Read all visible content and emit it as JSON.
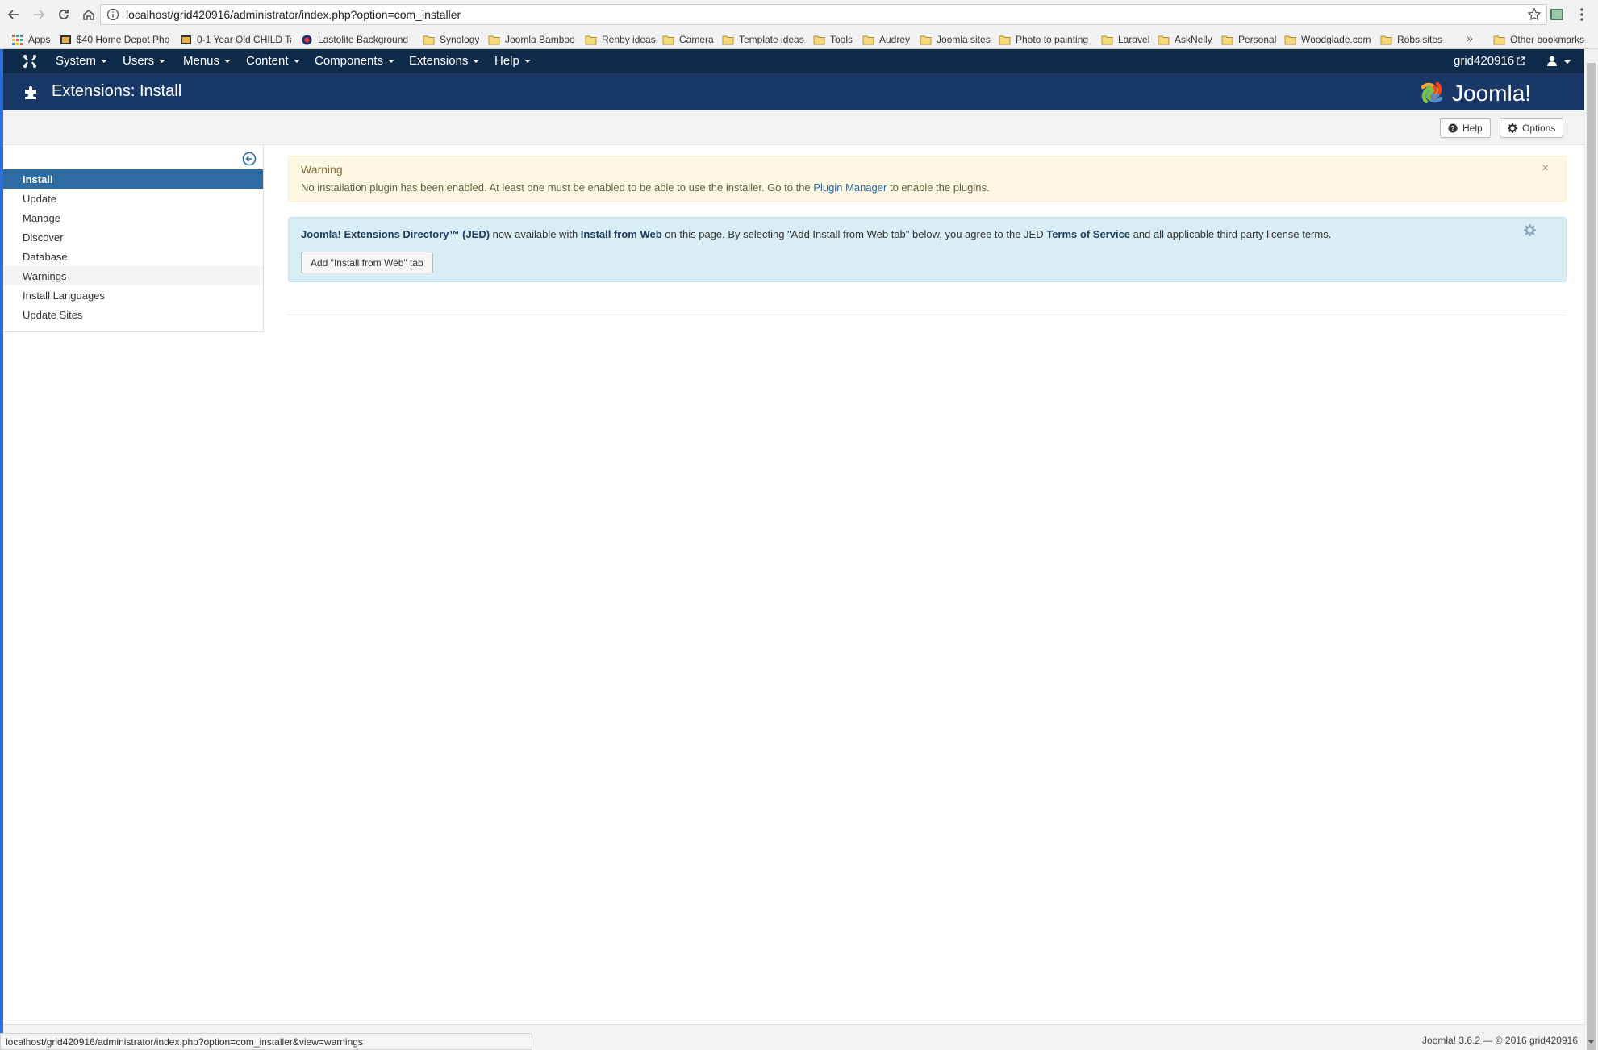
{
  "browser": {
    "url": "localhost/grid420916/administrator/index.php?option=com_installer",
    "status_url": "localhost/grid420916/administrator/index.php?option=com_installer&view=warnings",
    "bookmarks": [
      "Apps",
      "$40 Home Depot Pho",
      "0-1 Year Old CHILD Ta",
      "Lastolite Background",
      "Synology",
      "Joomla Bamboo",
      "Renby ideas",
      "Camera",
      "Template ideas",
      "Tools",
      "Audrey",
      "Joomla sites",
      "Photo to painting",
      "Laravel",
      "AskNelly",
      "Personal",
      "Woodglade.com",
      "Robs sites"
    ],
    "more_label": "»",
    "other_bookmarks": "Other bookmarks"
  },
  "nav": {
    "items": [
      "System",
      "Users",
      "Menus",
      "Content",
      "Components",
      "Extensions",
      "Help"
    ],
    "site_name": "grid420916"
  },
  "header": {
    "title": "Extensions: Install",
    "logo_text": "Joomla!"
  },
  "toolbar": {
    "help_label": "Help",
    "options_label": "Options"
  },
  "sidebar": {
    "items": [
      "Install",
      "Update",
      "Manage",
      "Discover",
      "Database",
      "Warnings",
      "Install Languages",
      "Update Sites"
    ],
    "active": "Install"
  },
  "warning": {
    "title": "Warning",
    "message_before": "No installation plugin has been enabled. At least one must be enabled to be able to use the installer. Go to the ",
    "link": "Plugin Manager",
    "message_after": " to enable the plugins.",
    "close": "×"
  },
  "jed": {
    "part1": "Joomla! Extensions Directory™ (JED)",
    "part2": " now available with ",
    "part3": "Install from Web",
    "part4": " on this page. By selecting \"Add Install from Web tab\" below, you agree to the JED ",
    "part5": "Terms of Service",
    "part6": " and all applicable third party license terms.",
    "button_label": "Add \"Install from Web\" tab"
  },
  "footer": {
    "text": "Joomla! 3.6.2 — © 2016 grid420916"
  },
  "colors": {
    "nav_bg": "#0f2b4c",
    "header_bg": "#1a3867",
    "active_item": "#2d6ca2",
    "warning_bg": "#fcf8e3",
    "info_bg": "#d9edf7"
  }
}
